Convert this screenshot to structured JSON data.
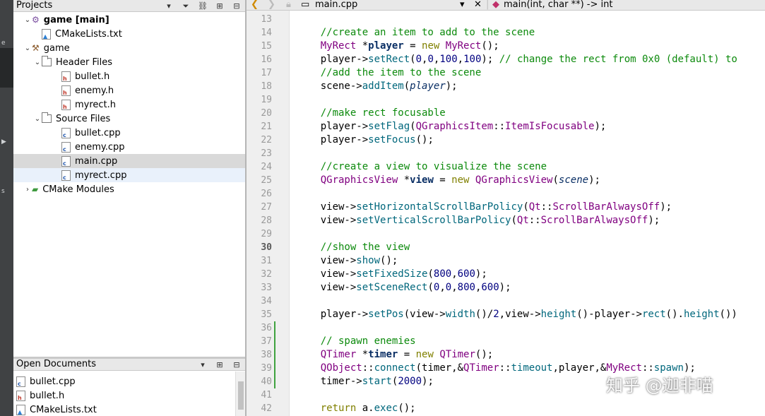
{
  "modebar": {
    "labels": [
      "e",
      "s"
    ]
  },
  "projects": {
    "title": "Projects",
    "tree": [
      {
        "label": "game [main]",
        "bold": true,
        "arrow": "expanded",
        "icon": "project-icon"
      },
      {
        "label": "CMakeLists.txt",
        "icon": "cmake-file-icon"
      },
      {
        "label": "game",
        "arrow": "expanded",
        "icon": "hammer-icon"
      },
      {
        "label": "Header Files",
        "arrow": "expanded",
        "icon": "folder-icon"
      },
      {
        "label": "bullet.h",
        "icon": "header-file-icon"
      },
      {
        "label": "enemy.h",
        "icon": "header-file-icon"
      },
      {
        "label": "myrect.h",
        "icon": "header-file-icon"
      },
      {
        "label": "Source Files",
        "arrow": "expanded",
        "icon": "folder-icon"
      },
      {
        "label": "bullet.cpp",
        "icon": "cpp-file-icon"
      },
      {
        "label": "enemy.cpp",
        "icon": "cpp-file-icon"
      },
      {
        "label": "main.cpp",
        "icon": "cpp-file-icon",
        "selected": true
      },
      {
        "label": "myrect.cpp",
        "icon": "cpp-file-icon",
        "hover": true
      },
      {
        "label": "CMake Modules",
        "arrow": "collapsed",
        "icon": "cmake-modules-icon"
      }
    ]
  },
  "open_documents": {
    "title": "Open Documents",
    "items": [
      "bullet.cpp",
      "bullet.h",
      "CMakeLists.txt"
    ]
  },
  "editor": {
    "file": "main.cpp",
    "symbol": "main(int, char **) -> int",
    "current_line": 30,
    "line_numbers": [
      13,
      14,
      15,
      16,
      17,
      18,
      19,
      20,
      21,
      22,
      23,
      24,
      25,
      26,
      27,
      28,
      29,
      30,
      31,
      32,
      33,
      34,
      35,
      36,
      37,
      38,
      39,
      40,
      41,
      42
    ],
    "lines": [
      [],
      [
        {
          "t": "    "
        },
        {
          "t": "//create an item to add to the scene",
          "c": "cm"
        }
      ],
      [
        {
          "t": "    "
        },
        {
          "t": "MyRect",
          "c": "ty"
        },
        {
          "t": " *"
        },
        {
          "t": "player",
          "c": "bd"
        },
        {
          "t": " = "
        },
        {
          "t": "new",
          "c": "kw"
        },
        {
          "t": " "
        },
        {
          "t": "MyRect",
          "c": "ty"
        },
        {
          "t": "();"
        }
      ],
      [
        {
          "t": "    player->"
        },
        {
          "t": "setRect",
          "c": "fn"
        },
        {
          "t": "("
        },
        {
          "t": "0",
          "c": "nm"
        },
        {
          "t": ","
        },
        {
          "t": "0",
          "c": "nm"
        },
        {
          "t": ","
        },
        {
          "t": "100",
          "c": "nm"
        },
        {
          "t": ","
        },
        {
          "t": "100",
          "c": "nm"
        },
        {
          "t": "); "
        },
        {
          "t": "// change the rect from 0x0 (default) to",
          "c": "cm"
        }
      ],
      [
        {
          "t": "    "
        },
        {
          "t": "//add the item to the scene",
          "c": "cm"
        }
      ],
      [
        {
          "t": "    scene->"
        },
        {
          "t": "addItem",
          "c": "fn"
        },
        {
          "t": "("
        },
        {
          "t": "player",
          "c": "it"
        },
        {
          "t": ");"
        }
      ],
      [],
      [
        {
          "t": "    "
        },
        {
          "t": "//make rect focusable",
          "c": "cm"
        }
      ],
      [
        {
          "t": "    player->"
        },
        {
          "t": "setFlag",
          "c": "fn"
        },
        {
          "t": "("
        },
        {
          "t": "QGraphicsItem",
          "c": "ty"
        },
        {
          "t": "::"
        },
        {
          "t": "ItemIsFocusable",
          "c": "en"
        },
        {
          "t": ");"
        }
      ],
      [
        {
          "t": "    player->"
        },
        {
          "t": "setFocus",
          "c": "fn"
        },
        {
          "t": "();"
        }
      ],
      [],
      [
        {
          "t": "    "
        },
        {
          "t": "//create a view to visualize the scene",
          "c": "cm"
        }
      ],
      [
        {
          "t": "    "
        },
        {
          "t": "QGraphicsView",
          "c": "ty"
        },
        {
          "t": " *"
        },
        {
          "t": "view",
          "c": "bd"
        },
        {
          "t": " = "
        },
        {
          "t": "new",
          "c": "kw"
        },
        {
          "t": " "
        },
        {
          "t": "QGraphicsView",
          "c": "ty"
        },
        {
          "t": "("
        },
        {
          "t": "scene",
          "c": "it"
        },
        {
          "t": ");"
        }
      ],
      [],
      [
        {
          "t": "    view->"
        },
        {
          "t": "setHorizontalScrollBarPolicy",
          "c": "fn"
        },
        {
          "t": "("
        },
        {
          "t": "Qt",
          "c": "ty"
        },
        {
          "t": "::"
        },
        {
          "t": "ScrollBarAlwaysOff",
          "c": "en"
        },
        {
          "t": ");"
        }
      ],
      [
        {
          "t": "    view->"
        },
        {
          "t": "setVerticalScrollBarPolicy",
          "c": "fn"
        },
        {
          "t": "("
        },
        {
          "t": "Qt",
          "c": "ty"
        },
        {
          "t": "::"
        },
        {
          "t": "ScrollBarAlwaysOff",
          "c": "en"
        },
        {
          "t": ");"
        }
      ],
      [],
      [
        {
          "t": "    "
        },
        {
          "t": "//show the view",
          "c": "cm"
        }
      ],
      [
        {
          "t": "    view->"
        },
        {
          "t": "show",
          "c": "fn"
        },
        {
          "t": "();"
        }
      ],
      [
        {
          "t": "    view->"
        },
        {
          "t": "setFixedSize",
          "c": "fn"
        },
        {
          "t": "("
        },
        {
          "t": "800",
          "c": "nm"
        },
        {
          "t": ","
        },
        {
          "t": "600",
          "c": "nm"
        },
        {
          "t": ");"
        }
      ],
      [
        {
          "t": "    view->"
        },
        {
          "t": "setSceneRect",
          "c": "fn"
        },
        {
          "t": "("
        },
        {
          "t": "0",
          "c": "nm"
        },
        {
          "t": ","
        },
        {
          "t": "0",
          "c": "nm"
        },
        {
          "t": ","
        },
        {
          "t": "800",
          "c": "nm"
        },
        {
          "t": ","
        },
        {
          "t": "600",
          "c": "nm"
        },
        {
          "t": ");"
        }
      ],
      [],
      [
        {
          "t": "    player->"
        },
        {
          "t": "setPos",
          "c": "fn"
        },
        {
          "t": "(view->"
        },
        {
          "t": "width",
          "c": "fn"
        },
        {
          "t": "()/"
        },
        {
          "t": "2",
          "c": "nm"
        },
        {
          "t": ",view->"
        },
        {
          "t": "height",
          "c": "fn"
        },
        {
          "t": "()-player->"
        },
        {
          "t": "rect",
          "c": "fn"
        },
        {
          "t": "()."
        },
        {
          "t": "height",
          "c": "fn"
        },
        {
          "t": "())"
        }
      ],
      [],
      [
        {
          "t": "    "
        },
        {
          "t": "// spawn enemies",
          "c": "cm"
        }
      ],
      [
        {
          "t": "    "
        },
        {
          "t": "QTimer",
          "c": "ty"
        },
        {
          "t": " *"
        },
        {
          "t": "timer",
          "c": "bd"
        },
        {
          "t": " = "
        },
        {
          "t": "new",
          "c": "kw"
        },
        {
          "t": " "
        },
        {
          "t": "QTimer",
          "c": "ty"
        },
        {
          "t": "();"
        }
      ],
      [
        {
          "t": "    "
        },
        {
          "t": "QObject",
          "c": "ty"
        },
        {
          "t": "::"
        },
        {
          "t": "connect",
          "c": "fn"
        },
        {
          "t": "(timer,&"
        },
        {
          "t": "QTimer",
          "c": "ty"
        },
        {
          "t": "::"
        },
        {
          "t": "timeout",
          "c": "fn"
        },
        {
          "t": ",player,&"
        },
        {
          "t": "MyRect",
          "c": "ty"
        },
        {
          "t": "::"
        },
        {
          "t": "spawn",
          "c": "fn"
        },
        {
          "t": ");"
        }
      ],
      [
        {
          "t": "    timer->"
        },
        {
          "t": "start",
          "c": "fn"
        },
        {
          "t": "("
        },
        {
          "t": "2000",
          "c": "nm"
        },
        {
          "t": ");"
        }
      ],
      [],
      [
        {
          "t": "    "
        },
        {
          "t": "return",
          "c": "kw"
        },
        {
          "t": " a."
        },
        {
          "t": "exec",
          "c": "fn"
        },
        {
          "t": "();"
        }
      ]
    ]
  },
  "watermark": "知乎 @迦非喵",
  "colors": {
    "comment": "#0c8a0c",
    "type": "#800080",
    "keyword": "#808000",
    "function": "#00677c",
    "number": "#000080",
    "modified_marker": "#3fa23f"
  }
}
